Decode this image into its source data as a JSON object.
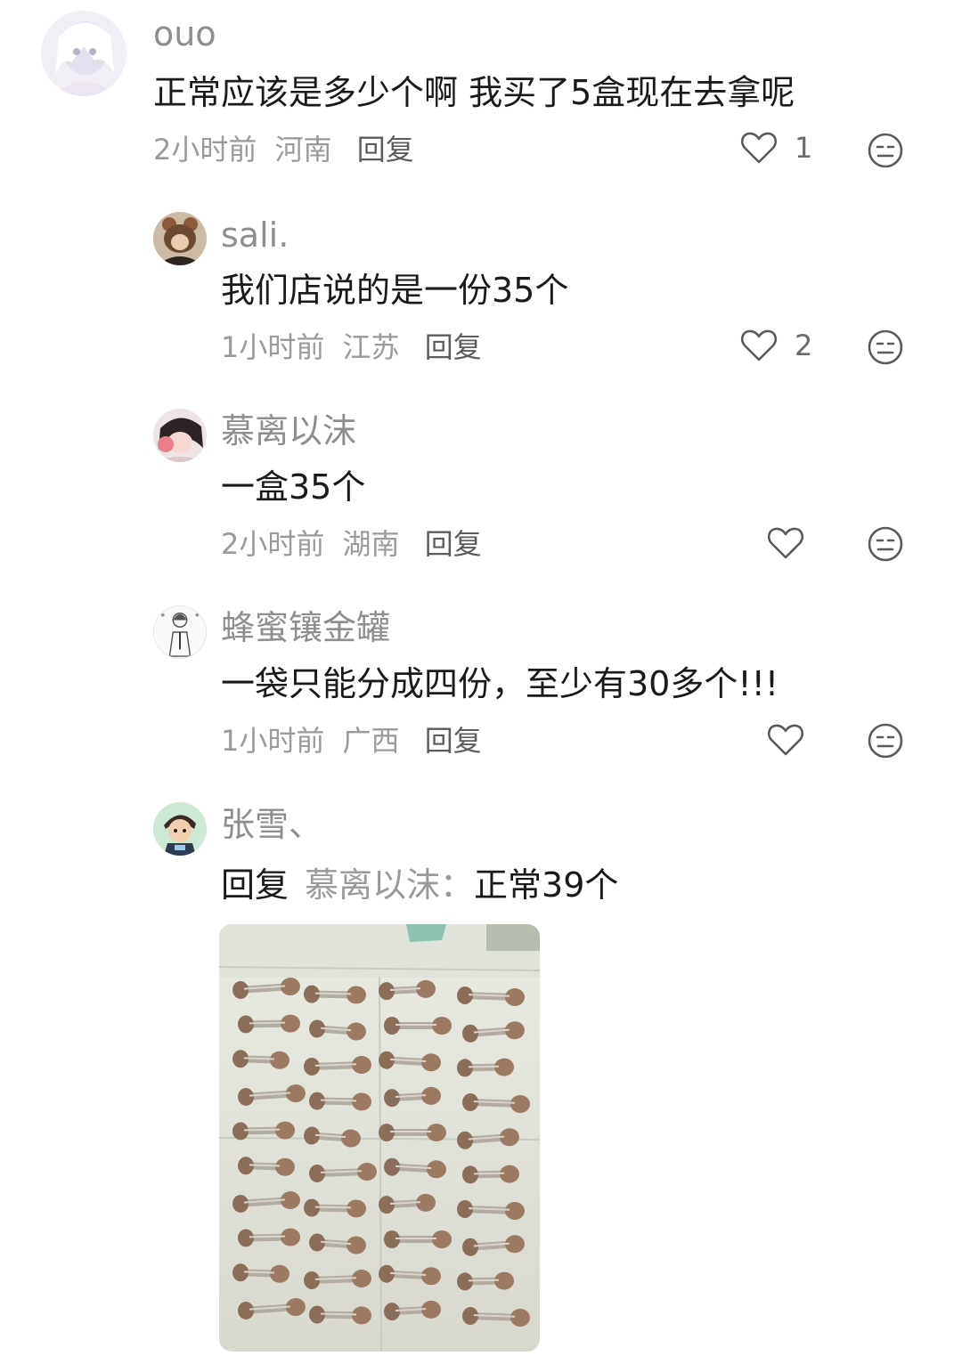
{
  "comments": [
    {
      "user": "ouo",
      "text": "正常应该是多少个啊 我买了5盒现在去拿呢",
      "time": "2小时前",
      "location": "河南",
      "reply_label": "回复",
      "likes": "1"
    },
    {
      "user": "sali.",
      "text": "我们店说的是一份35个",
      "time": "1小时前",
      "location": "江苏",
      "reply_label": "回复",
      "likes": "2"
    },
    {
      "user": "慕离以沫",
      "text": "一盒35个",
      "time": "2小时前",
      "location": "湖南",
      "reply_label": "回复",
      "likes": ""
    },
    {
      "user": "蜂蜜镶金罐",
      "text": "一袋只能分成四份，至少有30多个!!!",
      "time": "1小时前",
      "location": "广西",
      "reply_label": "回复",
      "likes": ""
    },
    {
      "user": "张雪、",
      "reply_prefix": "回复",
      "reply_target": "慕离以沫",
      "reply_colon": "：",
      "text": "正常39个"
    }
  ],
  "icons": {
    "like": "heart-outline-icon",
    "dislike": "meh-face-icon"
  },
  "colors": {
    "username": "#8e8e8e",
    "text": "#1a1a1a",
    "meta": "#9a9a9a"
  }
}
